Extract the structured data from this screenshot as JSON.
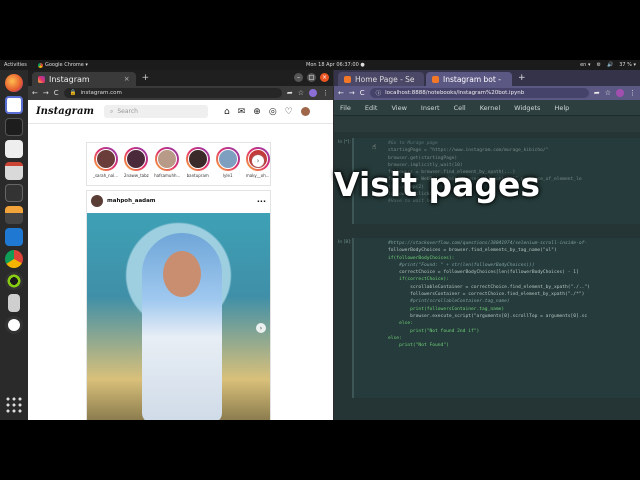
{
  "topbar": {
    "activities": "Activities",
    "app": "Google Chrome ▾",
    "clock": "Mon 18 Apr  06:37:00 ●",
    "tray": [
      "en ▾",
      "⚙",
      "🔊",
      "37 % ▾"
    ]
  },
  "left_browser": {
    "tab_title": "Instagram",
    "tab_close": "×",
    "new_tab": "+",
    "url": "instagram.com",
    "nav": {
      "back": "←",
      "forward": "→",
      "reload": "C"
    },
    "window_controls": {
      "minimize": "–",
      "maximize": "□",
      "close": "×"
    }
  },
  "instagram": {
    "logo": "Instagram",
    "search_placeholder": "Search",
    "header_icons": [
      "⌂",
      "✉",
      "⊕",
      "◎",
      "♡"
    ],
    "stories": [
      {
        "name": "_sarah_nal...",
        "color": "#6a3d3a"
      },
      {
        "name": "2naww_tabz",
        "color": "#4a2a3a"
      },
      {
        "name": "hafsamuhh...",
        "color": "#b89a88"
      },
      {
        "name": "bantupram",
        "color": "#3b2a2a"
      },
      {
        "name": "lyle1",
        "color": "#7f9fc0"
      },
      {
        "name": "maky__oh...",
        "color": "#c43a3a"
      }
    ],
    "story_next": "›",
    "post": {
      "username": "mahpoh_aadam",
      "more": "···",
      "next": "›"
    }
  },
  "right_browser": {
    "tabs": [
      {
        "title": "Home Page - Se",
        "active": false
      },
      {
        "title": "Instagram bot -",
        "active": true
      }
    ],
    "new_tab": "+",
    "url": "localhost:8888/notebooks/Instagram%20bot.ipynb",
    "menu": [
      "File",
      "Edit",
      "View",
      "Insert",
      "Cell",
      "Kernel",
      "Widgets",
      "Help"
    ]
  },
  "notebook": {
    "cell1_prompt": "In [*]:",
    "cell1_lines": [
      "#Go to Murage page",
      "startingPage = \"https://www.instagram.com/murage_kibicho/\"",
      "browser.get(startingPage)",
      "browser.implicitly_wait(10)",
      "followers = browser.find_element_by_xpath(...)",
      "followers = WebDriverWait(browser, 20).until(EC.presence_of_element_lo",
      "time.sleep(2)",
      "followers.click()",
      "#Have to wait here"
    ],
    "cell2_prompt": "In [8]:",
    "cell2_lines": [
      "#https://stackoverflow.com/questions/38041974/selenium-scroll-inside-of-",
      "followerBodyChoices = browser.find_elements_by_tag_name(\"ul\")",
      "if(followerBodyChoices):",
      "    #print(\"Found: \" + str(len(followerBodyChoices)))",
      "    correctChoice = followerBodyChoices[len(followerBodyChoices) - 1]",
      "    if(correctChoice):",
      "        scrollableContainer = correctChoice.find_element_by_xpath(\"./..\")",
      "        followersContainer = correctChoice.find_element_by_xpath(\"./*\")",
      "        #print(scrollableContainer.tag_name)",
      "        print(followersContainer.tag_name)",
      "        browser.execute_script(\"arguments[0].scrollTop = arguments[0].sc",
      "    else:",
      "        print(\"Not found 2nd if\")",
      "else:",
      "    print(\"Not Found\")"
    ]
  },
  "overlay_caption": "Visit pages"
}
